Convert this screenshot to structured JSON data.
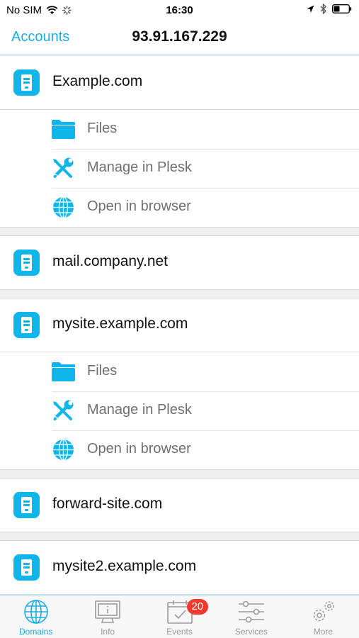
{
  "status_bar": {
    "carrier": "No SIM",
    "time": "16:30",
    "icons": [
      "wifi-icon",
      "activity-spinner-icon",
      "location-arrow-icon",
      "bluetooth-icon",
      "battery-icon"
    ]
  },
  "nav": {
    "back_label": "Accounts",
    "title": "93.91.167.229"
  },
  "colors": {
    "accent": "#1aaee6",
    "icon_blue": "#10b6e9",
    "badge_red": "#f23b2e",
    "muted_text": "#6f6f73"
  },
  "domains": [
    {
      "name": "Example.com",
      "expanded": true,
      "actions": [
        {
          "label": "Files",
          "icon": "folder-icon"
        },
        {
          "label": "Manage in Plesk",
          "icon": "tools-icon"
        },
        {
          "label": "Open in browser",
          "icon": "globe-icon"
        }
      ]
    },
    {
      "name": "mail.company.net",
      "expanded": false,
      "actions": []
    },
    {
      "name": "mysite.example.com",
      "expanded": true,
      "actions": [
        {
          "label": "Files",
          "icon": "folder-icon"
        },
        {
          "label": "Manage in Plesk",
          "icon": "tools-icon"
        },
        {
          "label": "Open in browser",
          "icon": "globe-icon"
        }
      ]
    },
    {
      "name": "forward-site.com",
      "expanded": false,
      "actions": []
    },
    {
      "name": "mysite2.example.com",
      "expanded": false,
      "actions": []
    }
  ],
  "tabbar": {
    "tabs": [
      {
        "label": "Domains",
        "icon": "globe-icon",
        "active": true
      },
      {
        "label": "Info",
        "icon": "monitor-info-icon",
        "active": false
      },
      {
        "label": "Events",
        "icon": "calendar-check-icon",
        "active": false,
        "badge": "20"
      },
      {
        "label": "Services",
        "icon": "sliders-icon",
        "active": false
      },
      {
        "label": "More",
        "icon": "gears-icon",
        "active": false
      }
    ]
  }
}
